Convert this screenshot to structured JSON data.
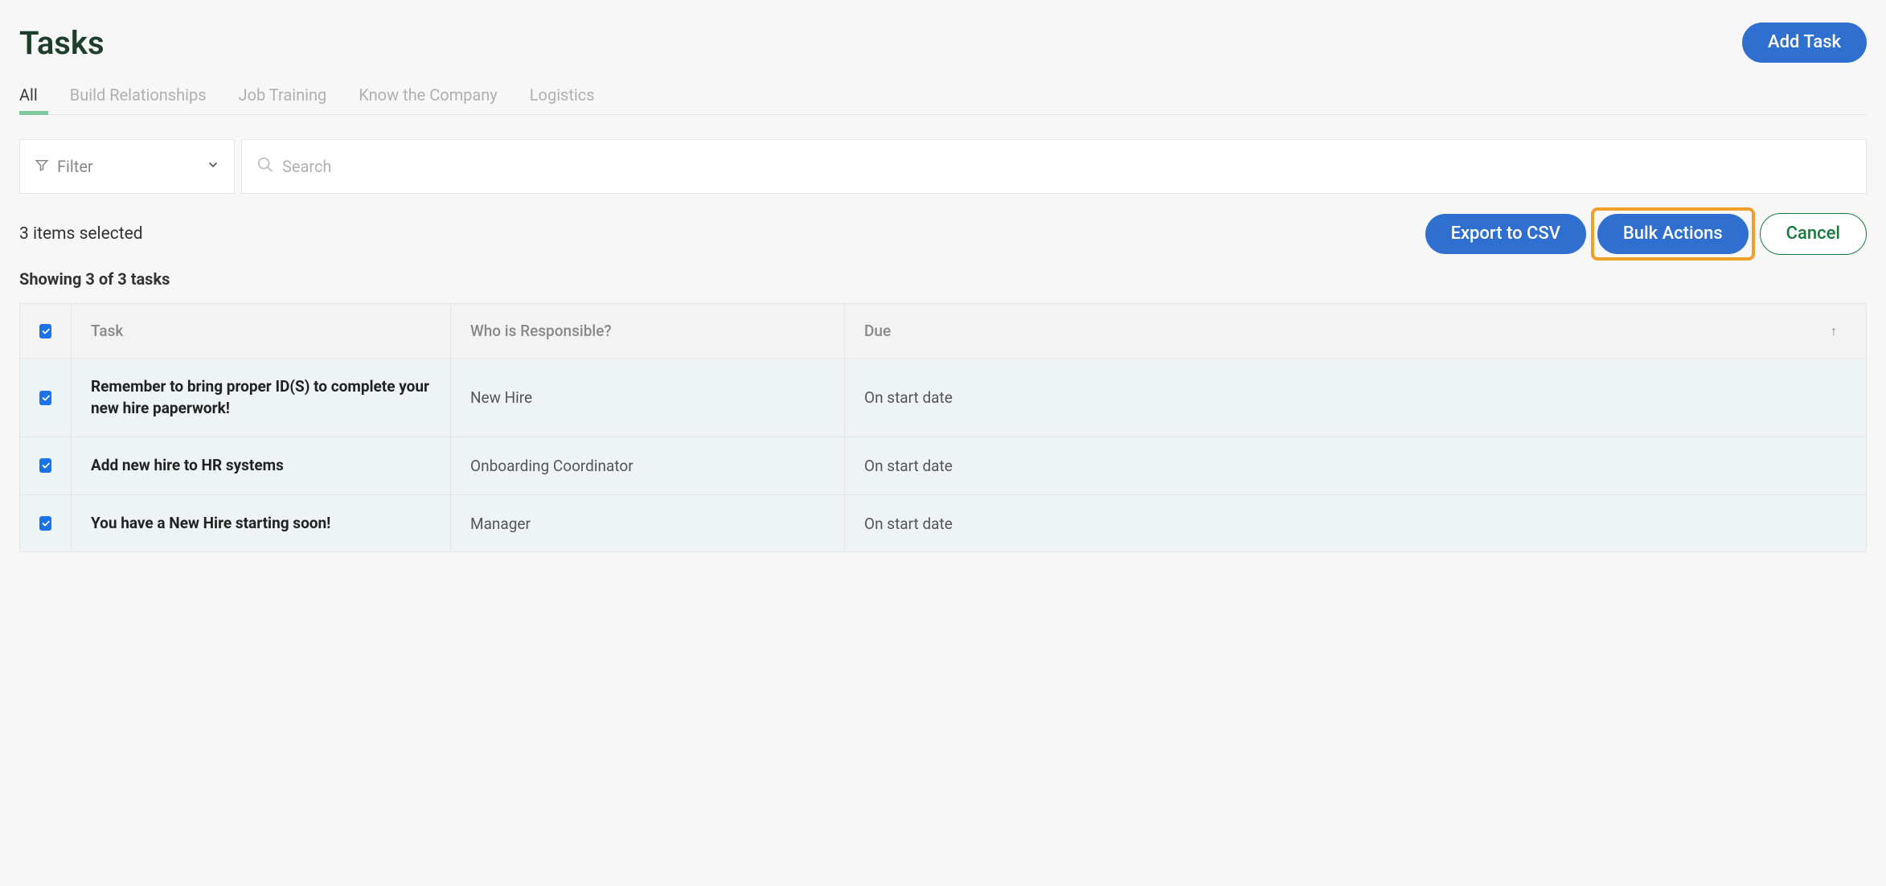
{
  "header": {
    "title": "Tasks",
    "add_button": "Add Task"
  },
  "tabs": [
    {
      "label": "All",
      "active": true
    },
    {
      "label": "Build Relationships",
      "active": false
    },
    {
      "label": "Job Training",
      "active": false
    },
    {
      "label": "Know the Company",
      "active": false
    },
    {
      "label": "Logistics",
      "active": false
    }
  ],
  "filter": {
    "label": "Filter"
  },
  "search": {
    "placeholder": "Search"
  },
  "selection": {
    "text": "3 items selected",
    "export_csv": "Export to CSV",
    "bulk_actions": "Bulk Actions",
    "cancel": "Cancel"
  },
  "showing": "Showing 3 of 3 tasks",
  "columns": {
    "task": "Task",
    "who": "Who is Responsible?",
    "due": "Due"
  },
  "rows": [
    {
      "task": "Remember to bring proper ID(S) to complete your new hire paperwork!",
      "who": "New Hire",
      "due": "On start date",
      "checked": true
    },
    {
      "task": "Add new hire to HR systems",
      "who": "Onboarding Coordinator",
      "due": "On start date",
      "checked": true
    },
    {
      "task": "You have a New Hire starting soon!",
      "who": "Manager",
      "due": "On start date",
      "checked": true
    }
  ]
}
